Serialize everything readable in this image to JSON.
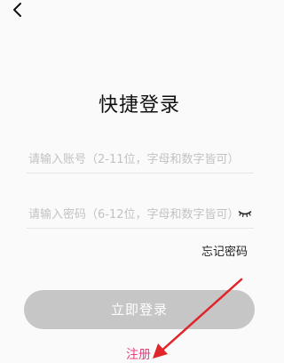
{
  "header": {
    "back_icon": "chevron-left-icon"
  },
  "main": {
    "title": "快捷登录",
    "account": {
      "placeholder": "请输入账号（2-11位，字母和数字皆可）",
      "value": ""
    },
    "password": {
      "placeholder": "请输入密码（6-12位，字母和数字皆可）",
      "value": "",
      "toggle_icon": "eye-closed-icon"
    },
    "forgot_label": "忘记密码",
    "login_label": "立即登录",
    "register_label": "注册"
  },
  "colors": {
    "background": "#fafafa",
    "login_button": "#c6c6c6",
    "register_link": "#e8407e",
    "annotation_arrow": "#e0262a"
  }
}
